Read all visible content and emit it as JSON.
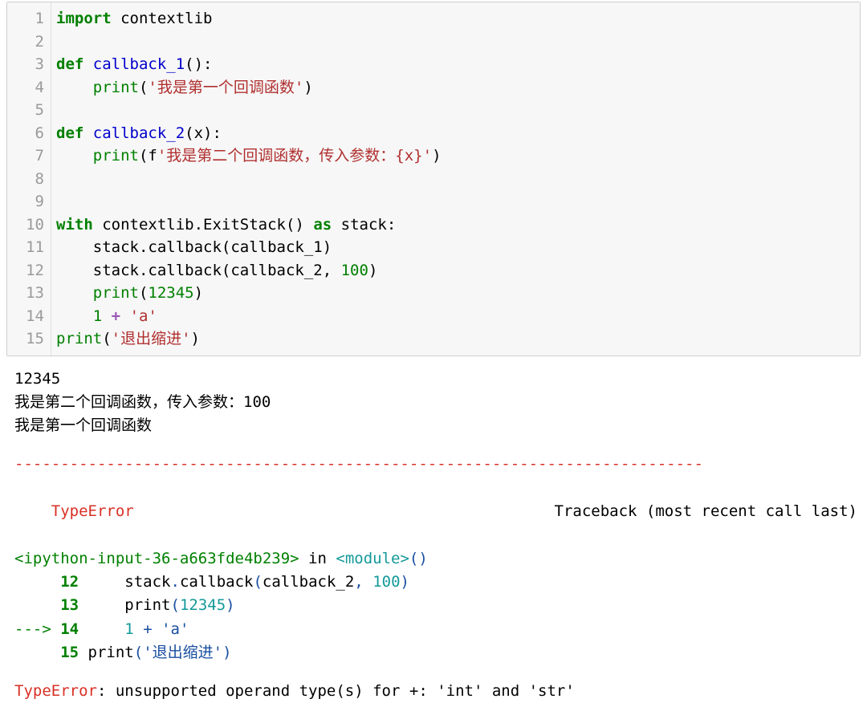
{
  "code": {
    "gutter": [
      "1",
      "2",
      "3",
      "4",
      "5",
      "6",
      "7",
      "8",
      "9",
      "10",
      "11",
      "12",
      "13",
      "14",
      "15"
    ],
    "l1": {
      "kw_import": "import",
      "mod": " contextlib"
    },
    "l3": {
      "kw_def": "def",
      "fn": " callback_1",
      "rest": "():"
    },
    "l4": {
      "indent": "    ",
      "call": "print",
      "p1": "(",
      "str": "'我是第一个回调函数'",
      "p2": ")"
    },
    "l6": {
      "kw_def": "def",
      "fn": " callback_2",
      "rest": "(x):"
    },
    "l7": {
      "indent": "    ",
      "call": "print",
      "p1": "(f",
      "str": "'我是第二个回调函数，传入参数：{x}'",
      "p2": ")"
    },
    "l10": {
      "kw_with": "with",
      "mid": " contextlib.ExitStack() ",
      "kw_as": "as",
      "rest": " stack:"
    },
    "l11": {
      "txt": "    stack.callback(callback_1)"
    },
    "l12": {
      "pre": "    stack.callback(callback_2, ",
      "num": "100",
      "post": ")"
    },
    "l13": {
      "indent": "    ",
      "call": "print",
      "p1": "(",
      "num": "12345",
      "p2": ")"
    },
    "l14": {
      "pre": "    ",
      "num": "1",
      "sp": " ",
      "op": "+",
      "sp2": " ",
      "str": "'a'"
    },
    "l15": {
      "call": "print",
      "p1": "(",
      "str": "'退出缩进'",
      "p2": ")"
    }
  },
  "stdout": {
    "l1": "12345",
    "l2": "我是第二个回调函数，传入参数：100",
    "l3": "我是第一个回调函数"
  },
  "traceback": {
    "rule": "---------------------------------------------------------------------------",
    "err_name": "TypeError",
    "header_right": "Traceback (most recent call last)",
    "frame": {
      "file": "<ipython-input-36-a663fde4b239>",
      "in": " in ",
      "mod": "<module>",
      "parens": "()"
    },
    "line12": {
      "no": "     12",
      "pad": "     ",
      "txt1": "stack",
      "dot1": ".",
      "txt2": "callback",
      "p1": "(",
      "txt3": "callback_2",
      "comma": ", ",
      "num": "100",
      "p2": ")"
    },
    "line13": {
      "no": "     13",
      "pad": "     ",
      "call": "print",
      "p1": "(",
      "num": "12345",
      "p2": ")"
    },
    "line14": {
      "arrow": "---> ",
      "no": "14",
      "pad": "     ",
      "num": "1",
      "sp": " ",
      "op": "+",
      "sp2": " ",
      "str": "'a'"
    },
    "line15": {
      "no": "     15",
      "pad": " ",
      "call": "print",
      "p1": "(",
      "str": "'退出缩进'",
      "p2": ")"
    },
    "final_pre": "TypeError",
    "final_msg": ": unsupported operand type(s) for +: 'int' and 'str'"
  }
}
